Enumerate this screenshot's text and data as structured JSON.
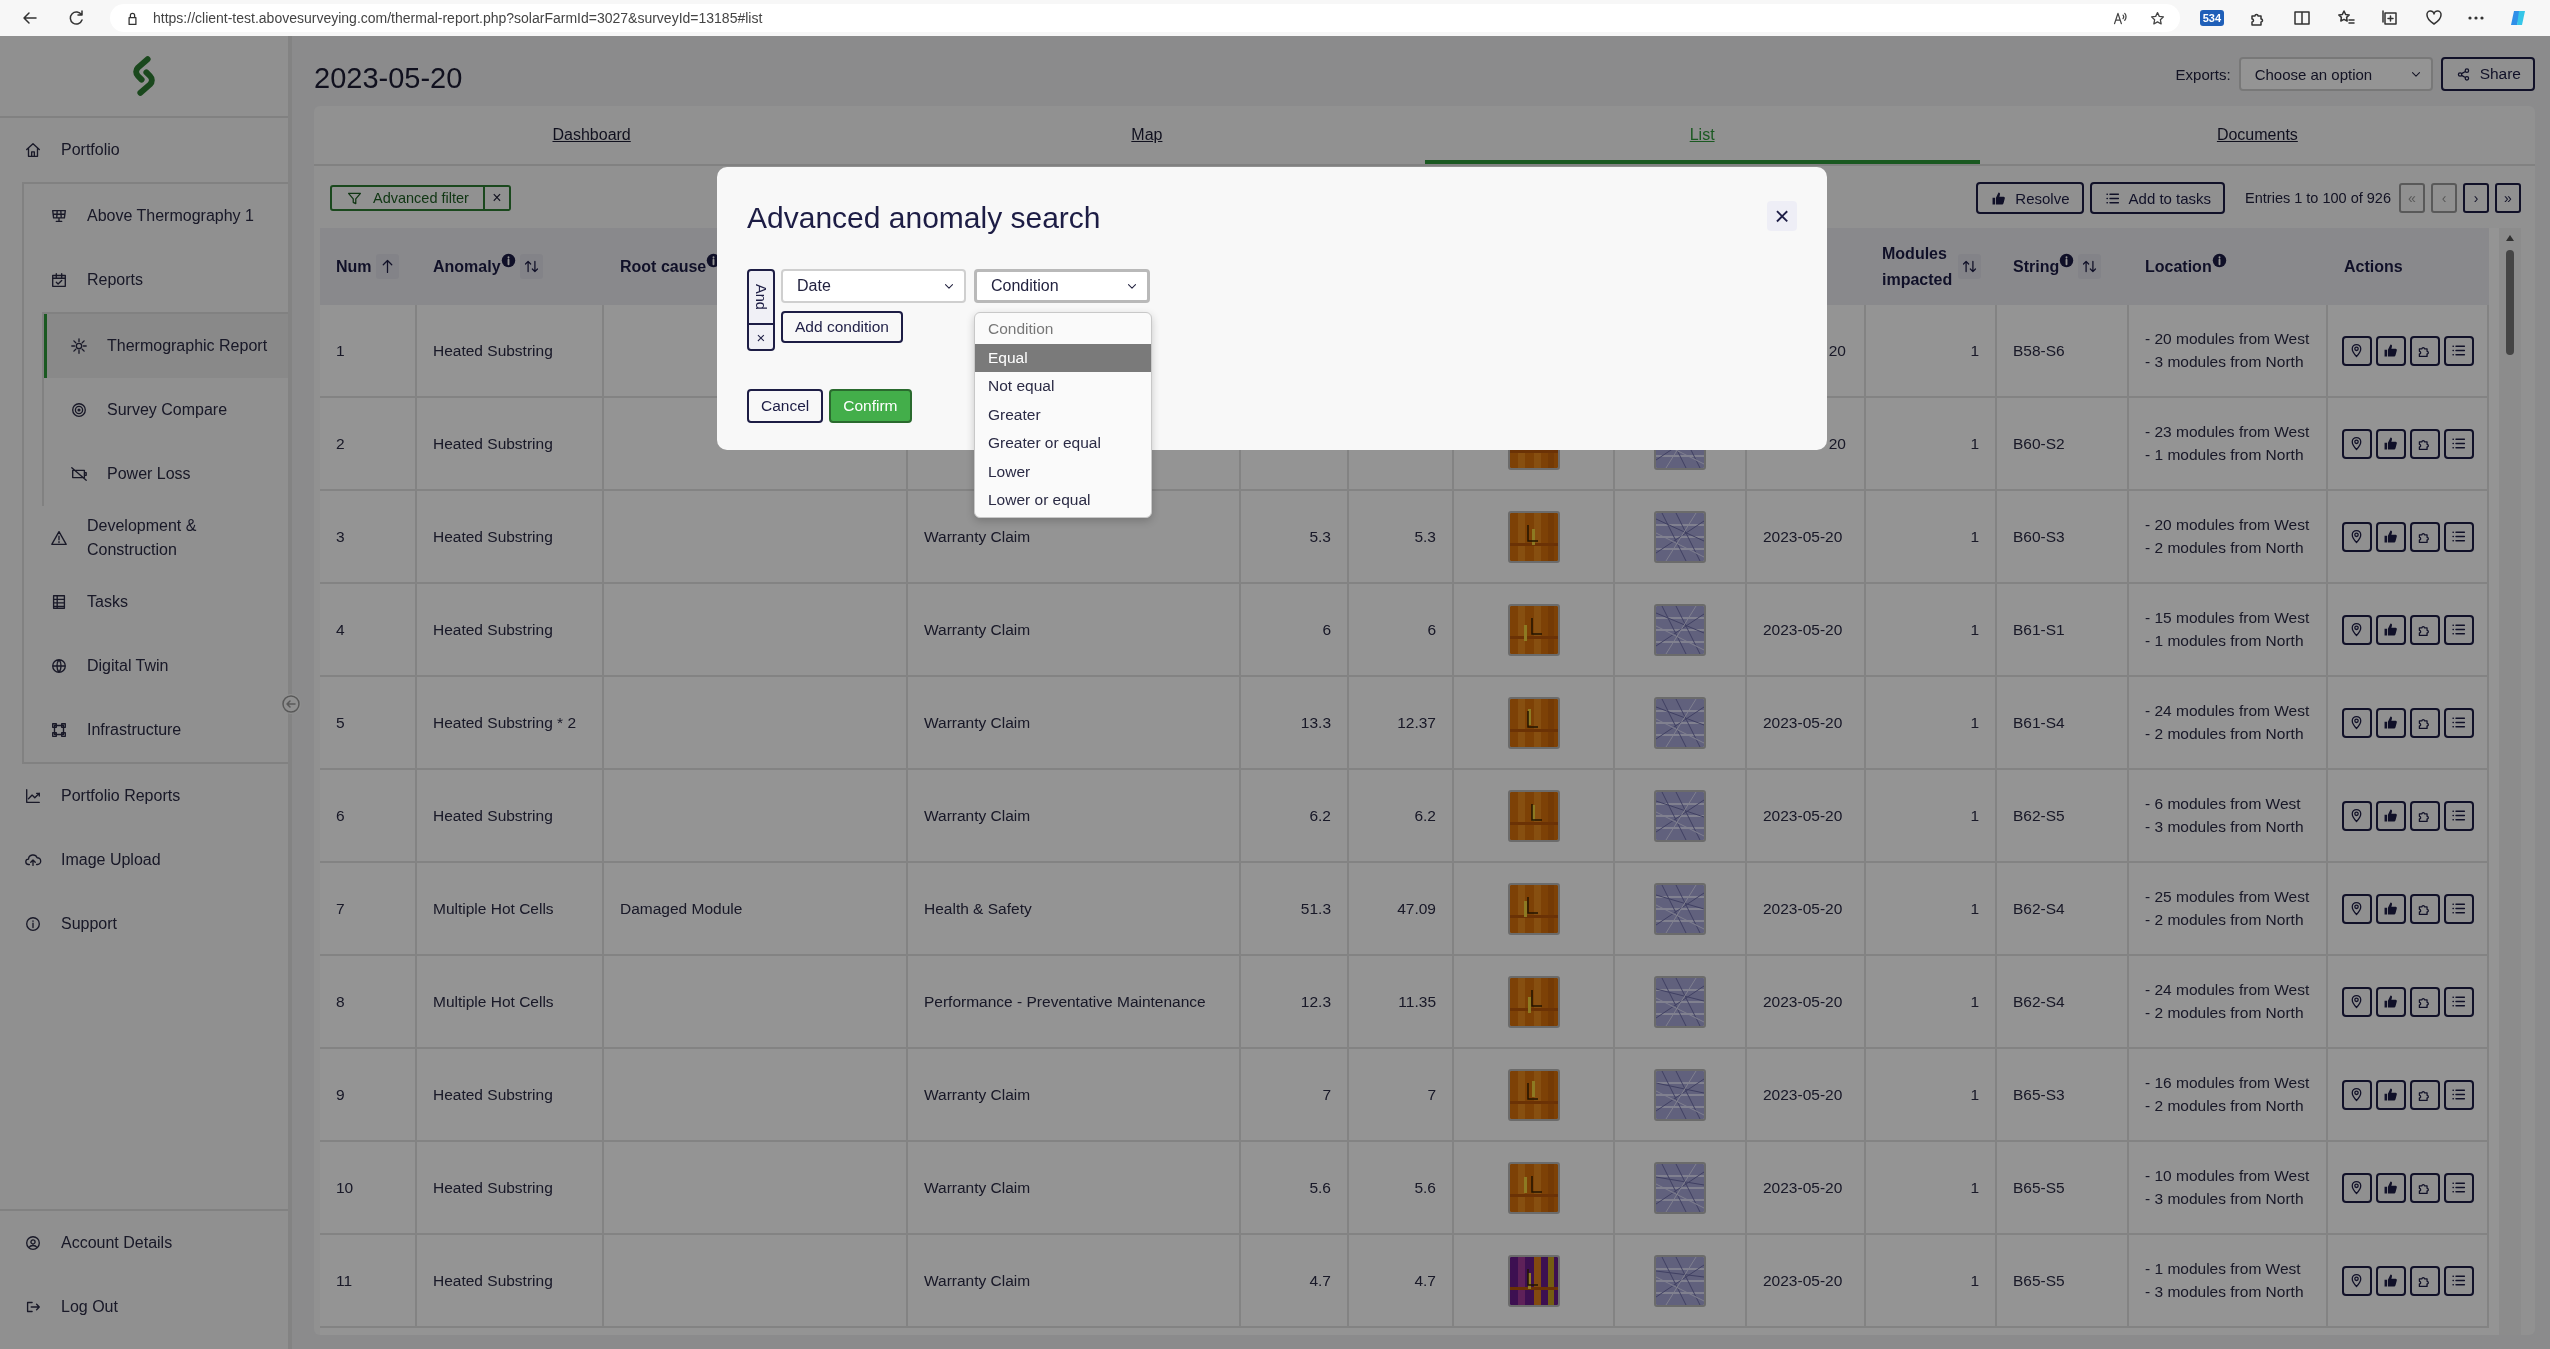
{
  "browser": {
    "url": "https://client-test.abovesurveying.com/thermal-report.php?solarFarmId=3027&surveyId=13185#list",
    "badge": "534"
  },
  "sidebar": {
    "items": [
      {
        "label": "Portfolio",
        "selected": false,
        "children": [
          {
            "label": "Above Thermography 1",
            "selected": false
          },
          {
            "label": "Reports",
            "selected": false,
            "children": [
              {
                "label": "Thermographic Report",
                "selected": true
              },
              {
                "label": "Survey Compare",
                "selected": false
              },
              {
                "label": "Power Loss",
                "selected": false
              }
            ]
          },
          {
            "label": "Development & Construction",
            "selected": false
          },
          {
            "label": "Tasks",
            "selected": false
          },
          {
            "label": "Digital Twin",
            "selected": false
          },
          {
            "label": "Infrastructure",
            "selected": false
          }
        ]
      },
      {
        "label": "Portfolio Reports",
        "selected": false
      },
      {
        "label": "Image Upload",
        "selected": false
      },
      {
        "label": "Support",
        "selected": false
      }
    ],
    "footer_items": [
      {
        "label": "Account Details",
        "selected": false
      },
      {
        "label": "Log Out",
        "selected": false
      }
    ]
  },
  "page": {
    "title": "2023-05-20",
    "exports_label": "Exports:",
    "exports_value": "Choose an option",
    "share": "Share"
  },
  "tabs": [
    {
      "label": "Dashboard",
      "selected": false
    },
    {
      "label": "Map",
      "selected": false
    },
    {
      "label": "List",
      "selected": true
    },
    {
      "label": "Documents",
      "selected": false
    }
  ],
  "toolbar": {
    "filter": "Advanced filter",
    "filter_clear": "×",
    "resolve": "Resolve",
    "add_to_tasks": "Add to tasks",
    "entries": "Entries 1 to 100 of 926",
    "pager": [
      {
        "label": "«",
        "disabled": true
      },
      {
        "label": "‹",
        "disabled": true
      },
      {
        "label": "›",
        "disabled": false
      },
      {
        "label": "»",
        "disabled": false
      }
    ]
  },
  "table": {
    "columns": [
      {
        "label": "Num",
        "info": false,
        "sortable": true,
        "sorted": true
      },
      {
        "label": "Anomaly",
        "info": true,
        "sortable": true,
        "sorted": false
      },
      {
        "label": "Root cause",
        "info": true,
        "sortable": false
      },
      {
        "label": "Modules impacted",
        "info": false,
        "sortable": true,
        "sorted": false
      },
      {
        "label": "String",
        "info": true,
        "sortable": true,
        "sorted": false
      },
      {
        "label": "Location",
        "info": true,
        "sortable": false
      },
      {
        "label": "Actions",
        "info": false,
        "sortable": false
      }
    ],
    "rows": [
      {
        "num": "1",
        "anomaly": "Heated Substring",
        "covered": true,
        "images_shown": false,
        "date": "20",
        "modules": "1",
        "string": "B58-S6",
        "location": [
          "- 20 modules from West",
          "- 3 modules from North"
        ]
      },
      {
        "num": "2",
        "anomaly": "Heated Substring",
        "covered": true,
        "images_shown": true,
        "date": "20",
        "modules": "1",
        "string": "B60-S2",
        "location": [
          "- 23 modules from West",
          "- 1 modules from North"
        ]
      },
      {
        "num": "3",
        "anomaly": "Heated Substring",
        "covered": false,
        "images_shown": true,
        "category": "Warranty Claim",
        "value_1": "5.3",
        "value_2": "5.3",
        "date": "2023-05-20",
        "modules": "1",
        "string": "B60-S3",
        "location": [
          "- 20 modules from West",
          "- 2 modules from North"
        ]
      },
      {
        "num": "4",
        "anomaly": "Heated Substring",
        "covered": false,
        "images_shown": true,
        "category": "Warranty Claim",
        "value_1": "6",
        "value_2": "6",
        "date": "2023-05-20",
        "modules": "1",
        "string": "B61-S1",
        "location": [
          "- 15 modules from West",
          "- 1 modules from North"
        ]
      },
      {
        "num": "5",
        "anomaly": "Heated Substring * 2",
        "covered": false,
        "images_shown": true,
        "category": "Warranty Claim",
        "value_1": "13.3",
        "value_2": "12.37",
        "date": "2023-05-20",
        "modules": "1",
        "string": "B61-S4",
        "location": [
          "- 24 modules from West",
          "- 2 modules from North"
        ]
      },
      {
        "num": "6",
        "anomaly": "Heated Substring",
        "covered": false,
        "images_shown": true,
        "category": "Warranty Claim",
        "value_1": "6.2",
        "value_2": "6.2",
        "date": "2023-05-20",
        "modules": "1",
        "string": "B62-S5",
        "location": [
          "- 6 modules from West",
          "- 3 modules from North"
        ]
      },
      {
        "num": "7",
        "anomaly": "Multiple Hot Cells",
        "root_cause": "Damaged Module",
        "covered": false,
        "images_shown": true,
        "category": "Health & Safety",
        "value_1": "51.3",
        "value_2": "47.09",
        "date": "2023-05-20",
        "modules": "1",
        "string": "B62-S4",
        "location": [
          "- 25 modules from West",
          "- 2 modules from North"
        ]
      },
      {
        "num": "8",
        "anomaly": "Multiple Hot Cells",
        "covered": false,
        "images_shown": true,
        "category": "Performance - Preventative Maintenance",
        "value_1": "12.3",
        "value_2": "11.35",
        "date": "2023-05-20",
        "modules": "1",
        "string": "B62-S4",
        "location": [
          "- 24 modules from West",
          "- 2 modules from North"
        ]
      },
      {
        "num": "9",
        "anomaly": "Heated Substring",
        "covered": false,
        "images_shown": true,
        "category": "Warranty Claim",
        "value_1": "7",
        "value_2": "7",
        "date": "2023-05-20",
        "modules": "1",
        "string": "B65-S3",
        "location": [
          "- 16 modules from West",
          "- 2 modules from North"
        ]
      },
      {
        "num": "10",
        "anomaly": "Heated Substring",
        "covered": false,
        "images_shown": true,
        "category": "Warranty Claim",
        "value_1": "5.6",
        "value_2": "5.6",
        "date": "2023-05-20",
        "modules": "1",
        "string": "B65-S5",
        "location": [
          "- 10 modules from West",
          "- 3 modules from North"
        ]
      },
      {
        "num": "11",
        "anomaly": "Heated Substring",
        "covered": false,
        "images_shown": true,
        "category": "Warranty Claim",
        "value_1": "4.7",
        "value_2": "4.7",
        "date": "2023-05-20",
        "modules": "1",
        "string": "B65-S5",
        "location": [
          "- 1 modules from West",
          "- 3 modules from North"
        ]
      }
    ]
  },
  "modal": {
    "title": "Advanced anomaly search",
    "close": "×",
    "joiner": "And",
    "remove": "×",
    "field": "Date",
    "condition": "Condition",
    "add_condition": "Add condition",
    "cancel": "Cancel",
    "confirm": "Confirm",
    "options": [
      {
        "label": "Condition",
        "disabled": true,
        "selected": false
      },
      {
        "label": "Equal",
        "disabled": false,
        "selected": true
      },
      {
        "label": "Not equal",
        "disabled": false,
        "selected": false
      },
      {
        "label": "Greater",
        "disabled": false,
        "selected": false
      },
      {
        "label": "Greater or equal",
        "disabled": false,
        "selected": false
      },
      {
        "label": "Lower",
        "disabled": false,
        "selected": false
      },
      {
        "label": "Lower or equal",
        "disabled": false,
        "selected": false
      }
    ]
  }
}
